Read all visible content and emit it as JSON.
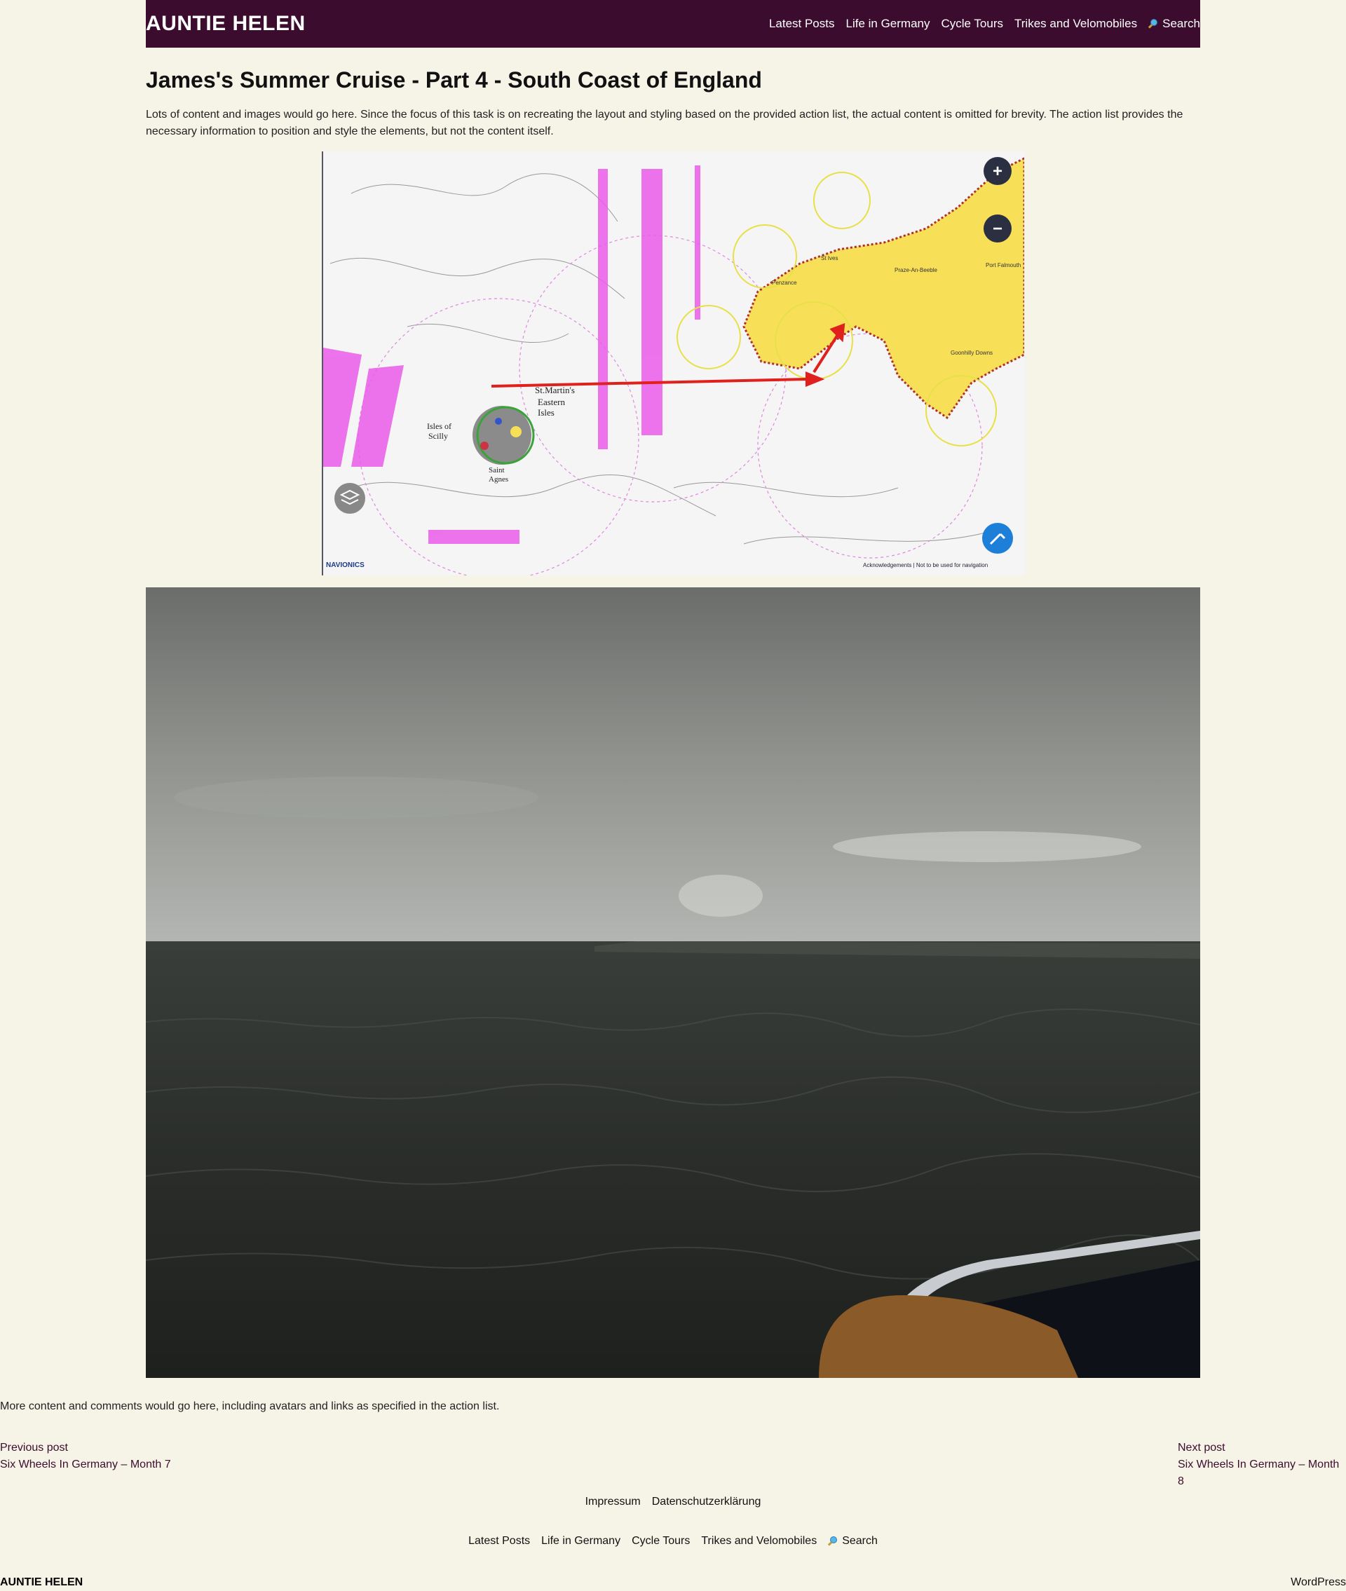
{
  "header": {
    "site_title": "AUNTIE HELEN",
    "nav": [
      {
        "label": "Latest Posts"
      },
      {
        "label": "Life in Germany"
      },
      {
        "label": "Cycle Tours"
      },
      {
        "label": "Trikes and Velomobiles"
      },
      {
        "label": "Search",
        "icon": "search-icon"
      }
    ],
    "background_color": "#3c0c2e"
  },
  "post": {
    "title": "James's Summer Cruise - Part 4 - South Coast of England",
    "intro": "Lots of content and images would go here. Since the focus of this task is on recreating the layout and styling based on the provided action list, the actual content is omitted for brevity. The action list provides the necessary information to position and style the elements, but not the content itself.",
    "map": {
      "labels": {
        "st_martins": "St.Martin's",
        "eastern": "Eastern",
        "isles": "Isles",
        "isles_of": "Isles of",
        "scilly": "Scilly",
        "saint": "Saint",
        "agnes": "Agnes",
        "penzance": "Penzance",
        "st_ives": "St Ives",
        "praze": "Praze-An-Beeble",
        "port_falmouth": "Port Falmouth",
        "goonhilly": "Goonhilly Downs",
        "navionics": "NAVIONICS",
        "footer": "Acknowledgements | Not to be used for navigation"
      },
      "controls": {
        "zoom_in": "+",
        "zoom_out": "−"
      }
    },
    "more_content": "More content and comments would go here, including avatars and links as specified in the action list."
  },
  "post_navigation": {
    "previous_label": "Previous post",
    "previous_title": "Six Wheels In Germany – Month 7",
    "next_label": "Next post",
    "next_title": "Six Wheels In Germany – Month 8"
  },
  "footer": {
    "legal_links": [
      {
        "label": "Impressum"
      },
      {
        "label": "Datenschutzerklärung"
      }
    ],
    "nav": [
      {
        "label": "Latest Posts"
      },
      {
        "label": "Life in Germany"
      },
      {
        "label": "Cycle Tours"
      },
      {
        "label": "Trikes and Velomobiles"
      },
      {
        "label": "Search",
        "icon": "search-icon"
      }
    ],
    "site_title": "AUNTIE HELEN",
    "credit": "WordPress"
  }
}
